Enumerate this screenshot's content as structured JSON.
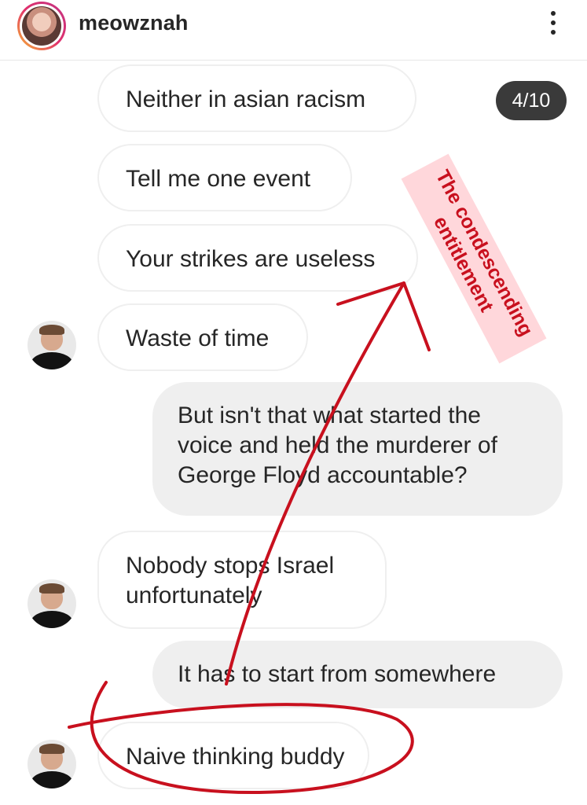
{
  "header": {
    "username": "meowznah",
    "avatar_icon": "profile-avatar",
    "menu_icon": "more-vertical-icon"
  },
  "counter": "4/10",
  "messages": [
    {
      "direction": "incoming",
      "text": "Neither in asian racism"
    },
    {
      "direction": "incoming",
      "text": "Tell me one event"
    },
    {
      "direction": "incoming",
      "text": "Your strikes are useless"
    },
    {
      "direction": "incoming",
      "text": "Waste of time"
    },
    {
      "direction": "outgoing",
      "lines": [
        "But isn't that what started the",
        "voice and held the murderer of",
        "George Floyd accountable?"
      ]
    },
    {
      "direction": "incoming",
      "lines": [
        "Nobody stops Israel",
        "unfortunately"
      ]
    },
    {
      "direction": "outgoing",
      "text": "It has to start from somewhere"
    },
    {
      "direction": "incoming",
      "text": "Naive thinking buddy"
    }
  ],
  "annotation": {
    "lines": [
      "The condescending",
      "entitlement"
    ],
    "color": "#c8101e",
    "highlight_color": "#ffb6be"
  }
}
